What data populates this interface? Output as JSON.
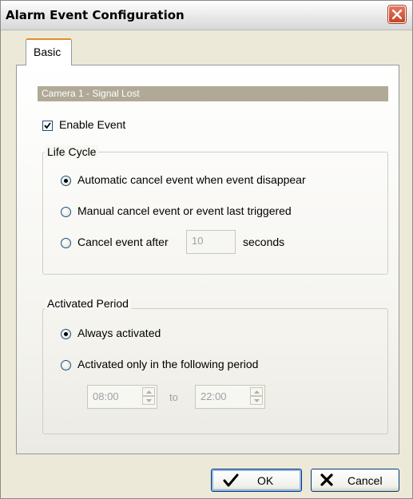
{
  "window": {
    "title": "Alarm Event Configuration"
  },
  "tabs": [
    {
      "label": "Basic",
      "selected": true
    }
  ],
  "camera_header": "Camera 1 - Signal Lost",
  "enable_event": {
    "label": "Enable Event",
    "checked": true
  },
  "life_cycle": {
    "title": "Life Cycle",
    "options": [
      {
        "label": "Automatic cancel event when event disappear",
        "selected": true
      },
      {
        "label": "Manual cancel event or event last triggered",
        "selected": false
      },
      {
        "label": "Cancel event after",
        "selected": false
      }
    ],
    "seconds_value": "10",
    "seconds_unit": "seconds"
  },
  "activated_period": {
    "title": "Activated Period",
    "options": [
      {
        "label": "Always activated",
        "selected": true
      },
      {
        "label": "Activated only in the following period",
        "selected": false
      }
    ],
    "start_time": "08:00",
    "to_label": "to",
    "end_time": "22:00"
  },
  "buttons": {
    "ok": "OK",
    "cancel": "Cancel"
  },
  "colors": {
    "camera_header_bg": "#b0a996",
    "tab_accent": "#e68b2c",
    "close_button": "#d4563b",
    "ok_check": "#000000"
  },
  "icons": {
    "close": "close-x-icon",
    "ok": "checkmark-icon",
    "cancel": "x-mark-icon",
    "spin_up": "arrow-up-icon",
    "spin_down": "arrow-down-icon"
  }
}
